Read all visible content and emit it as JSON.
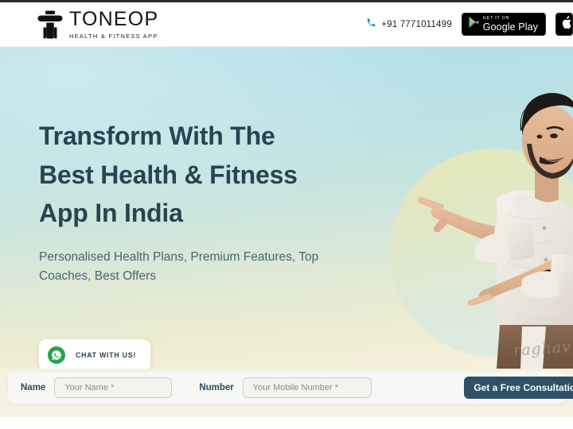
{
  "header": {
    "brand": {
      "name": "TONEOP",
      "tagline": "HEALTH & FITNESS APP",
      "logo_icon": "toneop-barbell-t-logo"
    },
    "phone": {
      "icon": "phone-icon",
      "number": "+91 7771011499",
      "icon_color": "#2196c4"
    },
    "badges": [
      {
        "small": "GET IT ON",
        "big": "Google Play",
        "icon": "google-play-icon"
      },
      {
        "small": "",
        "big": "",
        "icon": "app-store-icon"
      }
    ]
  },
  "hero": {
    "headline_lines": [
      "Transform With The",
      "Best Health & Fitness",
      "App In India"
    ],
    "subhead": "Personalised Health Plans, Premium Features, Top Coaches, Best Offers",
    "chat_button": {
      "label": "CHAT WITH US!",
      "icon": "whatsapp-icon",
      "icon_color": "#25a54b"
    },
    "signature": "raghav",
    "person_alt": "man-pointing-photo",
    "headline_color": "#294352"
  },
  "form": {
    "name_label": "Name",
    "name_placeholder": "Your Name *",
    "number_label": "Number",
    "number_placeholder": "Your Mobile Number *",
    "submit_label": "Get a Free Consultation",
    "submit_color": "#2f5166"
  }
}
